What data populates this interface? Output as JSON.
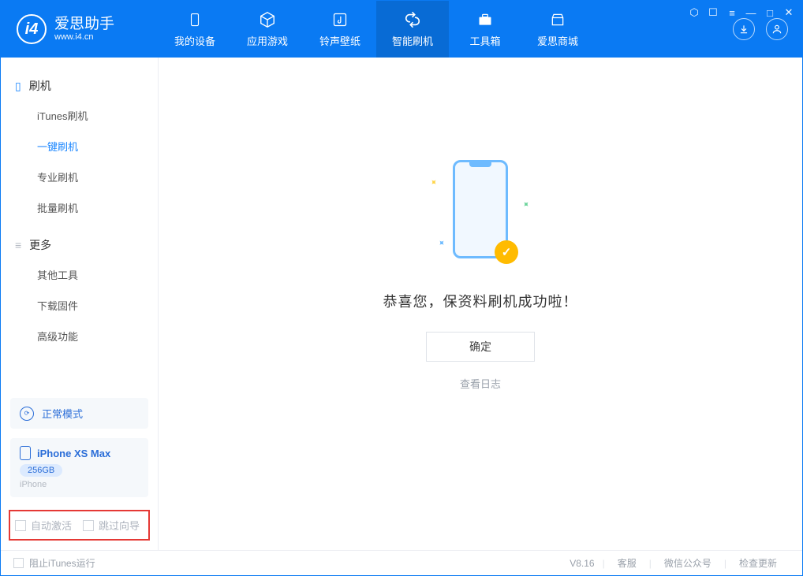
{
  "app": {
    "title": "爱思助手",
    "subtitle": "www.i4.cn"
  },
  "tabs": [
    {
      "label": "我的设备",
      "icon": "device"
    },
    {
      "label": "应用游戏",
      "icon": "cube"
    },
    {
      "label": "铃声壁纸",
      "icon": "note"
    },
    {
      "label": "智能刷机",
      "icon": "refresh",
      "active": true
    },
    {
      "label": "工具箱",
      "icon": "toolbox"
    },
    {
      "label": "爱思商城",
      "icon": "store"
    }
  ],
  "sidebar": {
    "group_flash": {
      "title": "刷机",
      "items": [
        "iTunes刷机",
        "一键刷机",
        "专业刷机",
        "批量刷机"
      ],
      "active_index": 1
    },
    "group_more": {
      "title": "更多",
      "items": [
        "其他工具",
        "下载固件",
        "高级功能"
      ]
    }
  },
  "mode": {
    "label": "正常模式"
  },
  "device": {
    "name": "iPhone XS Max",
    "storage": "256GB",
    "type": "iPhone"
  },
  "options": {
    "auto_activate": "自动激活",
    "skip_guide": "跳过向导"
  },
  "main": {
    "success_message": "恭喜您，保资料刷机成功啦！",
    "ok_button": "确定",
    "view_log": "查看日志"
  },
  "footer": {
    "block_itunes": "阻止iTunes运行",
    "version": "V8.16",
    "links": [
      "客服",
      "微信公众号",
      "检查更新"
    ]
  }
}
